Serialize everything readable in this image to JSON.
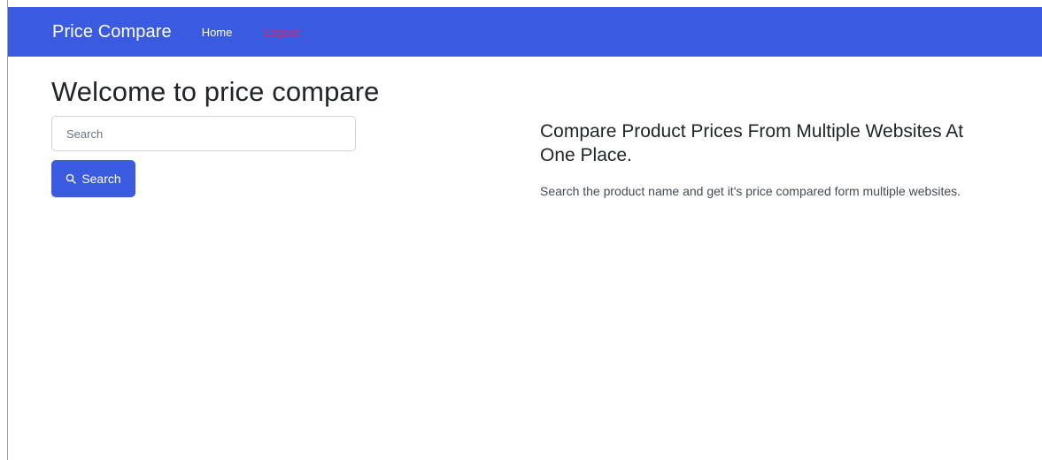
{
  "navbar": {
    "brand": "Price Compare",
    "links": [
      {
        "label": "Home"
      },
      {
        "label": "Logout"
      }
    ],
    "colors": {
      "background": "#3a5be0",
      "logout_text": "#e0245e"
    }
  },
  "main": {
    "title": "Welcome to price compare",
    "search": {
      "placeholder": "Search",
      "value": "",
      "button_label": "Search",
      "button_icon": "search-icon"
    },
    "promo": {
      "heading": "Compare Product Prices From Multiple Websites At One Place.",
      "text": "Search the product name and get it's price compared form multiple websites."
    }
  }
}
